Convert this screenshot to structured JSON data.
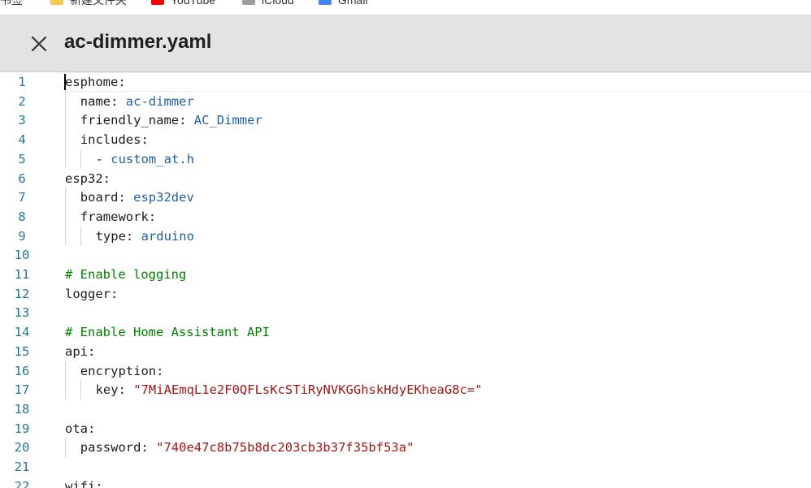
{
  "bookmarks": [
    {
      "label": "书签",
      "icon": "bookmark-icon",
      "color": ""
    },
    {
      "label": "新建文件夹",
      "icon": "folder-icon",
      "color": "#f2c94c"
    },
    {
      "label": "YouTube",
      "icon": "youtube-icon",
      "color": "#ff0000"
    },
    {
      "label": "iCloud",
      "icon": "cloud-icon",
      "color": "#9e9e9e"
    },
    {
      "label": "Gmail",
      "icon": "google-icon",
      "color": "#4285f4"
    }
  ],
  "header": {
    "title": "ac-dimmer.yaml",
    "close_icon": "close-icon"
  },
  "editor": {
    "lines": [
      {
        "n": "1",
        "indent": 0,
        "k": "esphome",
        "sep": ":",
        "v": "",
        "type": "key"
      },
      {
        "n": "2",
        "indent": 1,
        "k": "name",
        "sep": ": ",
        "v": "ac-dimmer",
        "type": "val"
      },
      {
        "n": "3",
        "indent": 1,
        "k": "friendly_name",
        "sep": ": ",
        "v": "AC_Dimmer",
        "type": "val"
      },
      {
        "n": "4",
        "indent": 1,
        "k": "includes",
        "sep": ":",
        "v": "",
        "type": "key"
      },
      {
        "n": "5",
        "indent": 2,
        "k": "- ",
        "sep": "",
        "v": "custom_at.h",
        "type": "val"
      },
      {
        "n": "6",
        "indent": 0,
        "k": "esp32",
        "sep": ":",
        "v": "",
        "type": "key"
      },
      {
        "n": "7",
        "indent": 1,
        "k": "board",
        "sep": ": ",
        "v": "esp32dev",
        "type": "val"
      },
      {
        "n": "8",
        "indent": 1,
        "k": "framework",
        "sep": ":",
        "v": "",
        "type": "key"
      },
      {
        "n": "9",
        "indent": 2,
        "k": "type",
        "sep": ": ",
        "v": "arduino",
        "type": "val"
      },
      {
        "n": "10",
        "indent": 0,
        "k": "",
        "sep": "",
        "v": "",
        "type": "empty"
      },
      {
        "n": "11",
        "indent": 0,
        "k": "",
        "sep": "",
        "v": "# Enable logging",
        "type": "comment"
      },
      {
        "n": "12",
        "indent": 0,
        "k": "logger",
        "sep": ":",
        "v": "",
        "type": "key"
      },
      {
        "n": "13",
        "indent": 0,
        "k": "",
        "sep": "",
        "v": "",
        "type": "empty"
      },
      {
        "n": "14",
        "indent": 0,
        "k": "",
        "sep": "",
        "v": "# Enable Home Assistant API",
        "type": "comment"
      },
      {
        "n": "15",
        "indent": 0,
        "k": "api",
        "sep": ":",
        "v": "",
        "type": "key"
      },
      {
        "n": "16",
        "indent": 1,
        "k": "encryption",
        "sep": ":",
        "v": "",
        "type": "key"
      },
      {
        "n": "17",
        "indent": 2,
        "k": "key",
        "sep": ": ",
        "v": "\"7MiAEmqL1e2F0QFLsKcSTiRyNVKGGhskHdyEKheaG8c=\"",
        "type": "str"
      },
      {
        "n": "18",
        "indent": 0,
        "k": "",
        "sep": "",
        "v": "",
        "type": "empty"
      },
      {
        "n": "19",
        "indent": 0,
        "k": "ota",
        "sep": ":",
        "v": "",
        "type": "key"
      },
      {
        "n": "20",
        "indent": 1,
        "k": "password",
        "sep": ": ",
        "v": "\"740e47c8b75b8dc203cb3b37f35bf53a\"",
        "type": "str"
      },
      {
        "n": "21",
        "indent": 0,
        "k": "",
        "sep": "",
        "v": "",
        "type": "empty"
      },
      {
        "n": "22",
        "indent": 0,
        "k": "wifi",
        "sep": ":",
        "v": "",
        "type": "key"
      }
    ]
  },
  "colors": {
    "line_number": "#237893",
    "value": "#1f5fa6",
    "string": "#a31515",
    "comment": "#008000"
  }
}
